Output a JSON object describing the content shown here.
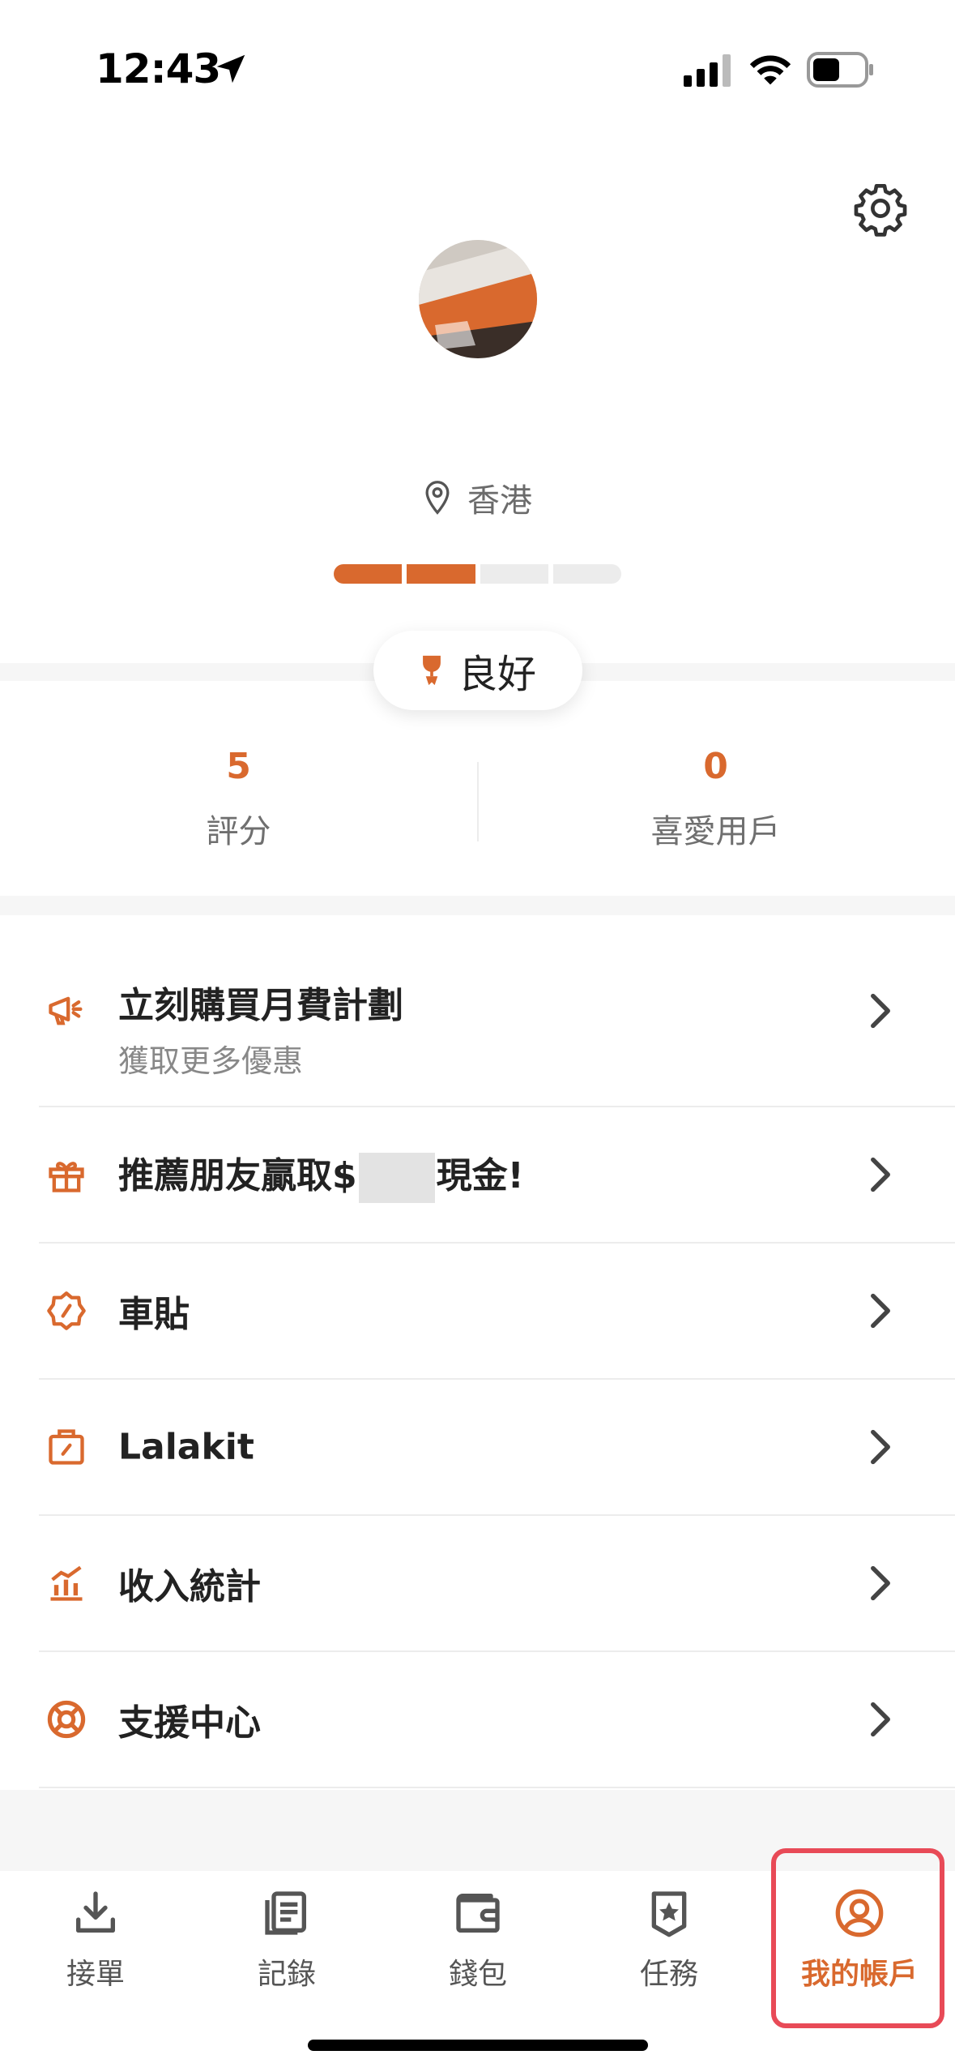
{
  "status_bar": {
    "time": "12:43"
  },
  "profile": {
    "location": "香港",
    "level_segments": 4,
    "level_filled": 2,
    "rating_label": "良好"
  },
  "stats": [
    {
      "value": "5",
      "label": "評分"
    },
    {
      "value": "0",
      "label": "喜愛用戶"
    }
  ],
  "menu": [
    {
      "title": "立刻購買月費計劃",
      "subtitle": "獲取更多優惠",
      "icon": "megaphone-icon"
    },
    {
      "title_prefix": "推薦朋友贏取$",
      "title_suffix": "現金!",
      "icon": "gift-icon"
    },
    {
      "title": "車貼",
      "icon": "badge-icon"
    },
    {
      "title": "Lalakit",
      "icon": "bag-icon"
    },
    {
      "title": "收入統計",
      "icon": "chart-icon"
    },
    {
      "title": "支援中心",
      "icon": "lifebuoy-icon"
    }
  ],
  "tabs": [
    {
      "label": "接單",
      "icon": "download-icon"
    },
    {
      "label": "記錄",
      "icon": "list-icon"
    },
    {
      "label": "錢包",
      "icon": "wallet-icon"
    },
    {
      "label": "任務",
      "icon": "star-badge-icon"
    },
    {
      "label": "我的帳戶",
      "icon": "account-icon",
      "active": true
    }
  ],
  "colors": {
    "accent": "#d9692e",
    "highlight": "#e84a57"
  }
}
